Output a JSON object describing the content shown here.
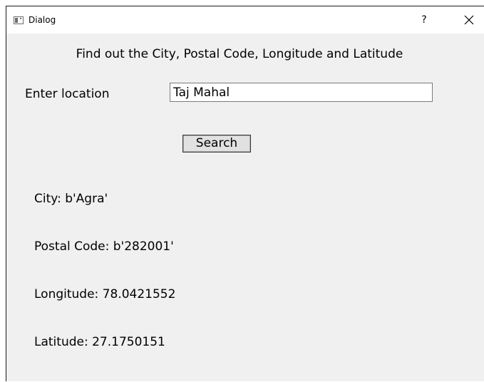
{
  "window": {
    "title": "Dialog",
    "help_label": "?",
    "icons": {
      "app": "window-app-icon",
      "help": "question-mark-icon",
      "close": "close-icon"
    }
  },
  "main": {
    "heading": "Find out the City, Postal Code, Longitude and Latitude",
    "location_label": "Enter location",
    "location_value": "Taj Mahal",
    "search_label": "Search"
  },
  "results": {
    "city": "City: b'Agra'",
    "postal_code": "Postal Code: b'282001'",
    "longitude": "Longitude: 78.0421552",
    "latitude": "Latitude: 27.1750151"
  },
  "colors": {
    "background": "#f0f0f0",
    "titlebar": "#ffffff",
    "text": "#000000"
  }
}
